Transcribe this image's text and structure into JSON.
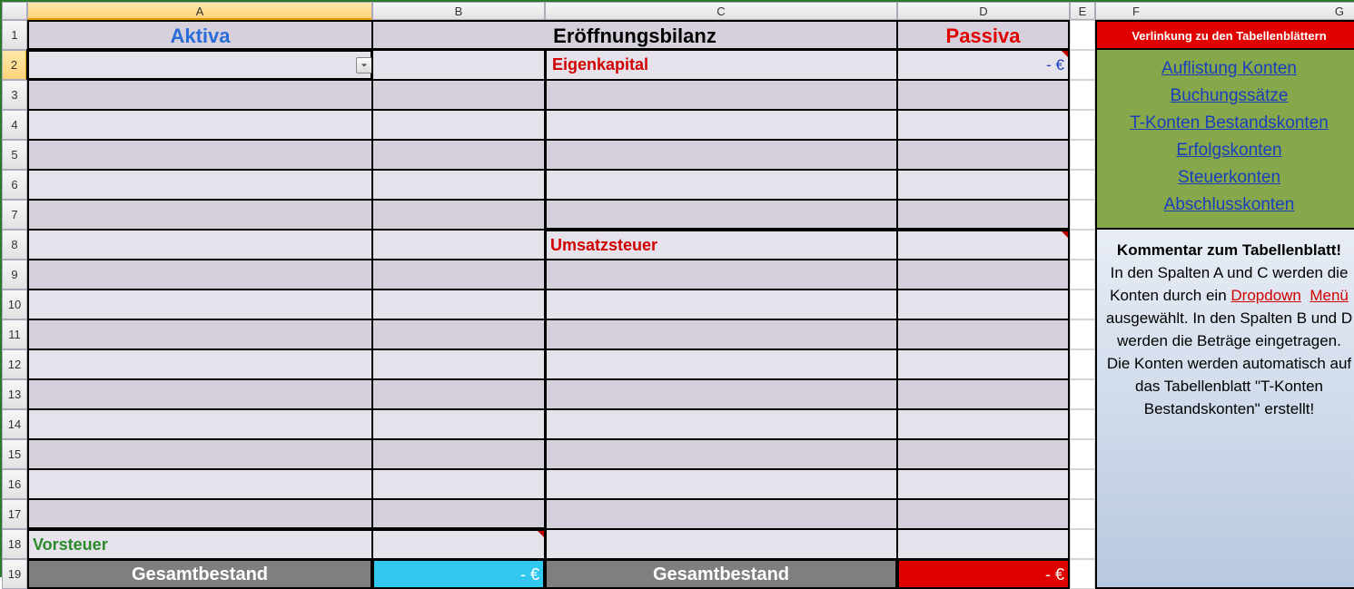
{
  "columns": [
    "A",
    "B",
    "C",
    "D",
    "E",
    "F",
    "G"
  ],
  "rows": [
    "1",
    "2",
    "3",
    "4",
    "5",
    "6",
    "7",
    "8",
    "9",
    "10",
    "11",
    "12",
    "13",
    "14",
    "15",
    "16",
    "17",
    "18",
    "19"
  ],
  "header": {
    "aktiva": "Aktiva",
    "bilanz": "Eröffnungsbilanz",
    "passiva": "Passiva"
  },
  "labels": {
    "eigenkapital": "Eigenkapital",
    "umsatzsteuer": "Umsatzsteuer",
    "vorsteuer": "Vorsteuer",
    "gesamt_a": "Gesamtbestand",
    "gesamt_c": "Gesamtbestand"
  },
  "values": {
    "d2": "-    €",
    "b19": "-    €",
    "d19": "-    €"
  },
  "sidebox": {
    "header": "Verlinkung zu den Tabellenblättern",
    "links": [
      "Auflistung Konten",
      "Buchungssätze",
      "T-Konten Bestandskonten",
      "Erfolgskonten",
      "Steuerkonten",
      "Abschlusskonten"
    ]
  },
  "comment": {
    "title": "Kommentar zum Tabellenblatt!",
    "pre": "In den Spalten A und C werden die Konten durch ein ",
    "dropdown": "Dropdown",
    "menu": "Menü",
    "post": " ausgewählt. In den Spalten B und D werden die Beträge eingetragen. Die Konten werden automatisch auf das Tabellenblatt \"T-Konten Bestandskonten\" erstellt!"
  }
}
